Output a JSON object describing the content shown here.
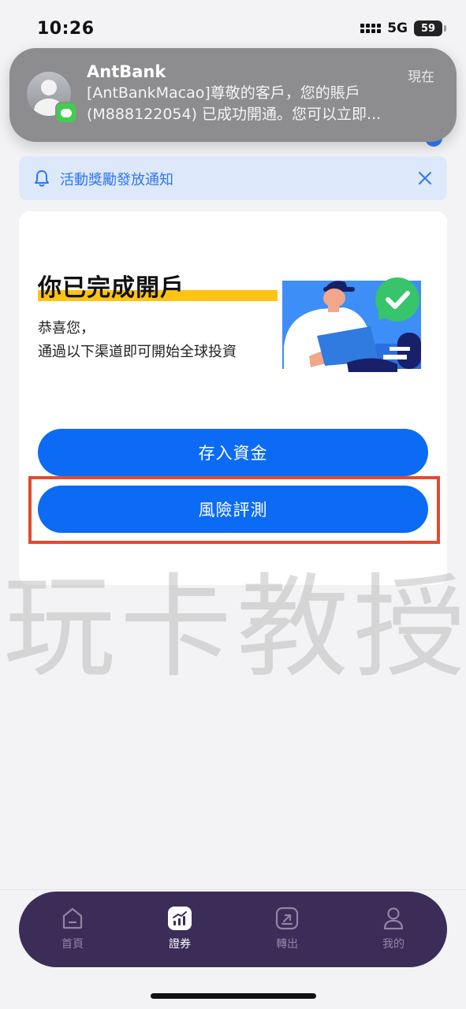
{
  "status": {
    "time": "10:26",
    "network": "5G",
    "battery": "59"
  },
  "notification": {
    "app": "AntBank",
    "time": "現在",
    "body": "[AntBankMacao]尊敬的客戶，您的賬戶(M888122054) 已成功開通。您可以立即..."
  },
  "info_banner": {
    "text": "活動獎勵發放通知"
  },
  "card": {
    "title": "你已完成開戶",
    "subtitle_line1": "恭喜您，",
    "subtitle_line2": "通過以下渠道即可開始全球投資",
    "deposit_label": "存入資金",
    "risk_label": "風險評測"
  },
  "watermark": "玩卡教授",
  "nav": {
    "items": [
      {
        "label": "首頁",
        "icon": "home-icon",
        "active": false
      },
      {
        "label": "證券",
        "icon": "securities-chart-icon",
        "active": true
      },
      {
        "label": "轉出",
        "icon": "transfer-out-icon",
        "active": false
      },
      {
        "label": "我的",
        "icon": "profile-icon",
        "active": false
      }
    ]
  },
  "colors": {
    "primary": "#0b6bf5",
    "highlight": "#e34a30",
    "nav_bg": "#3b2d58",
    "accent_yellow": "#ffc413"
  }
}
